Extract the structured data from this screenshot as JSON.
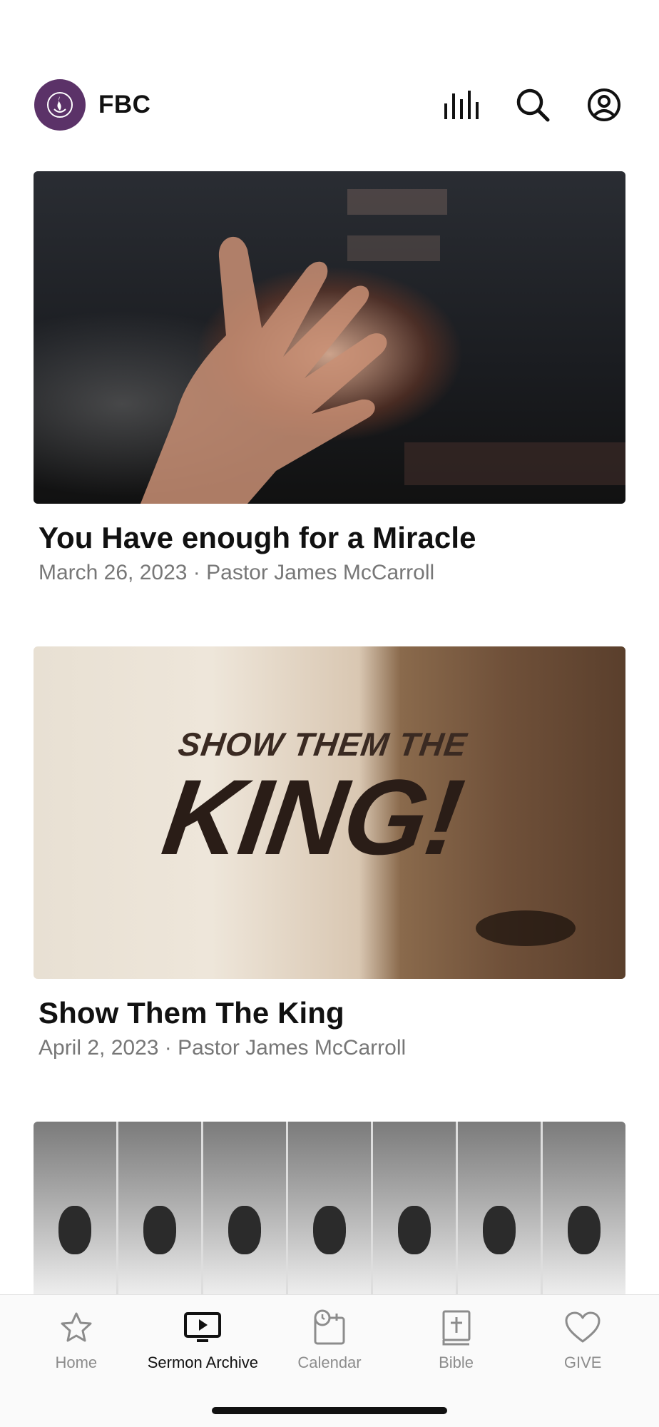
{
  "header": {
    "brand_name": "FBC",
    "icons": [
      "logo-icon",
      "audio-bars-icon",
      "search-icon",
      "account-icon"
    ]
  },
  "sermons": [
    {
      "title": "You Have enough for a Miracle",
      "meta": "March 26, 2023 · Pastor James McCarroll"
    },
    {
      "title": "Show Them The King",
      "meta": "April 2, 2023 · Pastor James McCarroll",
      "thumb_text_small": "SHOW THEM THE",
      "thumb_text_big": "KING!"
    },
    {
      "title": "",
      "meta": ""
    }
  ],
  "tabbar": {
    "items": [
      {
        "label": "Home",
        "icon": "star-icon",
        "active": false
      },
      {
        "label": "Sermon Archive",
        "icon": "tv-play-icon",
        "active": true
      },
      {
        "label": "Calendar",
        "icon": "calendar-clock-icon",
        "active": false
      },
      {
        "label": "Bible",
        "icon": "bible-icon",
        "active": false
      },
      {
        "label": "GIVE",
        "icon": "heart-icon",
        "active": false
      }
    ]
  },
  "colors": {
    "brand": "#5b3268",
    "active_tab": "#111111",
    "inactive_tab": "#8c8c8c"
  }
}
